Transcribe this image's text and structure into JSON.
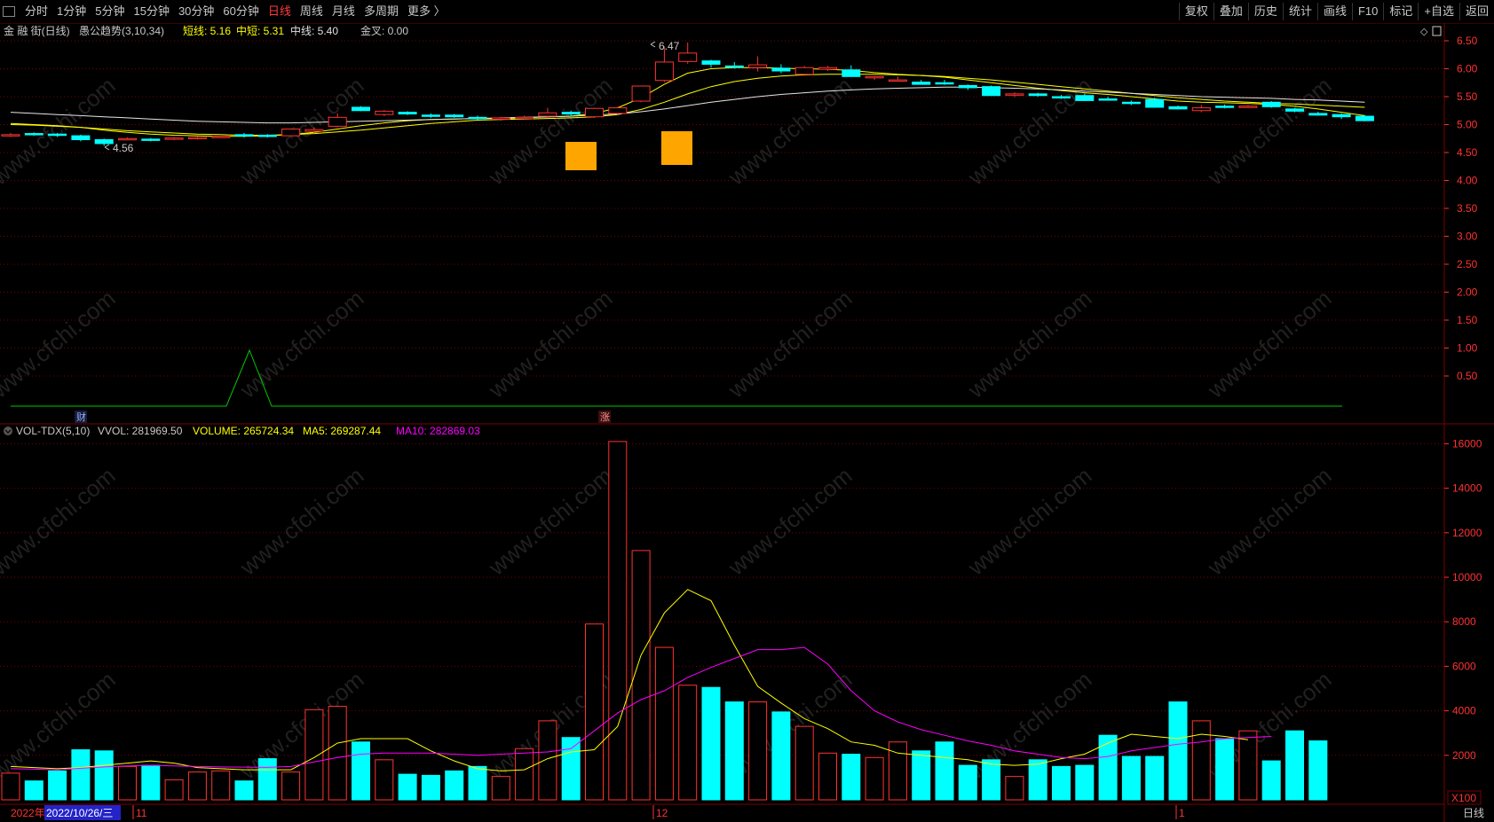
{
  "toolbar": {
    "periods": [
      "分时",
      "1分钟",
      "5分钟",
      "15分钟",
      "30分钟",
      "60分钟",
      "日线",
      "周线",
      "月线",
      "多周期",
      "更多 〉"
    ],
    "active_period": "日线",
    "right_buttons": [
      "复权",
      "叠加",
      "历史",
      "统计",
      "画线",
      "F10",
      "标记",
      "+自选",
      "返回"
    ]
  },
  "main_panel": {
    "stock_name": "金 融 街(日线)",
    "indicator_name": "愚公趋势(3,10,34)",
    "legend": [
      {
        "label": "短线: 5.16",
        "color": "#ffff00"
      },
      {
        "label": "中短: 5.31",
        "color": "#ffff00"
      },
      {
        "label": "中线: 5.40",
        "color": "#e0e0e0"
      },
      {
        "label": "金叉: 0.00",
        "color": "#c8c8c8"
      }
    ],
    "high_marker": "6.47",
    "low_marker": "4.56",
    "event_markers": [
      "财",
      "涨"
    ],
    "price_axis": [
      "6.50",
      "6.00",
      "5.50",
      "5.00",
      "4.50",
      "4.00",
      "3.50",
      "3.00",
      "2.50",
      "2.00",
      "1.50",
      "1.00",
      "0.50"
    ]
  },
  "volume_panel": {
    "indicator_name": "VOL-TDX(5,10)",
    "legend": [
      {
        "label": "VVOL: 281969.50",
        "color": "#c8c8c8"
      },
      {
        "label": "VOLUME: 265724.34",
        "color": "#ffff00"
      },
      {
        "label": "MA5: 269287.44",
        "color": "#ffff00"
      },
      {
        "label": "MA10: 282869.03",
        "color": "#ff00ff"
      }
    ],
    "volume_axis": [
      "16000",
      "14000",
      "12000",
      "10000",
      "8000",
      "6000",
      "4000",
      "2000"
    ],
    "unit": "X100"
  },
  "date_axis": {
    "year_label": "2022年",
    "cursor_date": "2022/10/26/三",
    "month_labels": [
      "11",
      "12",
      "1"
    ],
    "period_label": "日线"
  },
  "watermark": "www.cfchi.com",
  "colors": {
    "up": "#ff3232",
    "down": "#00ffff",
    "ma_short": "#ffff00",
    "ma_mid": "#e6e6e6",
    "ma10": "#ff00ff",
    "signal": "#00c800",
    "grid": "#7a0000",
    "axis_text": "#ff3232"
  },
  "chart_data": {
    "type": "candlestick",
    "dates_span": [
      "2022-10-26",
      "2023-01-19"
    ],
    "candles": [
      [
        4.82,
        4.85,
        4.78,
        4.82
      ],
      [
        4.84,
        4.86,
        4.8,
        4.83
      ],
      [
        4.83,
        4.85,
        4.78,
        4.81
      ],
      [
        4.8,
        4.82,
        4.7,
        4.73
      ],
      [
        4.73,
        4.75,
        4.62,
        4.66
      ],
      [
        4.75,
        4.77,
        4.72,
        4.75
      ],
      [
        4.74,
        4.76,
        4.7,
        4.72
      ],
      [
        4.74,
        4.78,
        4.72,
        4.76
      ],
      [
        4.77,
        4.79,
        4.73,
        4.77
      ],
      [
        4.78,
        4.8,
        4.76,
        4.79
      ],
      [
        4.82,
        4.85,
        4.77,
        4.8
      ],
      [
        4.81,
        4.83,
        4.77,
        4.79
      ],
      [
        4.8,
        4.93,
        4.8,
        4.92
      ],
      [
        4.88,
        4.95,
        4.84,
        4.91
      ],
      [
        4.97,
        5.2,
        4.95,
        5.13
      ],
      [
        5.31,
        5.33,
        5.24,
        5.25
      ],
      [
        5.18,
        5.26,
        5.15,
        5.24
      ],
      [
        5.22,
        5.24,
        5.17,
        5.19
      ],
      [
        5.17,
        5.2,
        5.12,
        5.16
      ],
      [
        5.17,
        5.19,
        5.12,
        5.14
      ],
      [
        5.13,
        5.16,
        5.09,
        5.11
      ],
      [
        5.1,
        5.14,
        5.07,
        5.12
      ],
      [
        5.13,
        5.16,
        5.1,
        5.13
      ],
      [
        5.15,
        5.3,
        5.12,
        5.21
      ],
      [
        5.22,
        5.25,
        5.16,
        5.19
      ],
      [
        5.14,
        5.3,
        5.12,
        5.29
      ],
      [
        5.2,
        5.32,
        5.17,
        5.3
      ],
      [
        5.42,
        5.7,
        5.4,
        5.69
      ],
      [
        5.79,
        6.4,
        5.76,
        6.12
      ],
      [
        6.13,
        6.47,
        6.09,
        6.28
      ],
      [
        6.14,
        6.16,
        6.02,
        6.08
      ],
      [
        6.05,
        6.12,
        6.0,
        6.04
      ],
      [
        6.02,
        6.22,
        5.95,
        6.07
      ],
      [
        6.01,
        6.08,
        5.92,
        5.96
      ],
      [
        5.9,
        6.05,
        5.9,
        6.02
      ],
      [
        5.99,
        6.05,
        5.96,
        6.02
      ],
      [
        5.98,
        6.06,
        5.9,
        5.86
      ],
      [
        5.85,
        5.87,
        5.8,
        5.86
      ],
      [
        5.8,
        5.86,
        5.78,
        5.8
      ],
      [
        5.76,
        5.8,
        5.72,
        5.72
      ],
      [
        5.75,
        5.8,
        5.71,
        5.74
      ],
      [
        5.7,
        5.72,
        5.62,
        5.66
      ],
      [
        5.68,
        5.7,
        5.52,
        5.52
      ],
      [
        5.55,
        5.58,
        5.49,
        5.55
      ],
      [
        5.55,
        5.57,
        5.5,
        5.52
      ],
      [
        5.5,
        5.53,
        5.46,
        5.48
      ],
      [
        5.52,
        5.55,
        5.42,
        5.43
      ],
      [
        5.46,
        5.5,
        5.43,
        5.44
      ],
      [
        5.4,
        5.43,
        5.35,
        5.38
      ],
      [
        5.45,
        5.48,
        5.32,
        5.31
      ],
      [
        5.32,
        5.34,
        5.27,
        5.28
      ],
      [
        5.25,
        5.35,
        5.22,
        5.3
      ],
      [
        5.33,
        5.36,
        5.29,
        5.32
      ],
      [
        5.32,
        5.35,
        5.3,
        5.33
      ],
      [
        5.4,
        5.42,
        5.3,
        5.32
      ],
      [
        5.28,
        5.3,
        5.22,
        5.24
      ],
      [
        5.2,
        5.23,
        5.16,
        5.17
      ],
      [
        5.18,
        5.2,
        5.1,
        5.14
      ],
      [
        5.15,
        5.17,
        5.06,
        5.07
      ]
    ],
    "volume": [
      1200,
      850,
      1300,
      2250,
      2200,
      1500,
      1550,
      900,
      1250,
      1300,
      850,
      1850,
      1250,
      4050,
      4200,
      2600,
      1800,
      1150,
      1100,
      1300,
      1500,
      1050,
      2300,
      3550,
      2800,
      7900,
      16100,
      11200,
      6850,
      5150,
      5050,
      4400,
      4400,
      3950,
      3300,
      2100,
      2050,
      1900,
      2600,
      2200,
      2600,
      1550,
      1800,
      1050,
      1800,
      1500,
      1550,
      2900,
      1950,
      1950,
      4400,
      3550,
      2750,
      3100,
      1750,
      3100,
      2650
    ],
    "series": [
      {
        "name": "短线",
        "values": [
          5.02,
          5.0,
          4.98,
          4.95,
          4.9,
          4.86,
          4.83,
          4.81,
          4.8,
          4.79,
          4.79,
          4.8,
          4.82,
          4.86,
          4.92,
          4.98,
          5.03,
          5.07,
          5.09,
          5.1,
          5.11,
          5.11,
          5.12,
          5.14,
          5.15,
          5.2,
          5.3,
          5.48,
          5.72,
          5.92,
          6.0,
          6.02,
          6.02,
          6.01,
          6.0,
          5.99,
          5.97,
          5.93,
          5.9,
          5.88,
          5.85,
          5.8,
          5.75,
          5.7,
          5.65,
          5.61,
          5.57,
          5.54,
          5.5,
          5.46,
          5.42,
          5.4,
          5.39,
          5.38,
          5.36,
          5.33,
          5.28,
          5.22,
          5.16
        ]
      },
      {
        "name": "中短",
        "values": [
          5.0,
          4.99,
          4.97,
          4.95,
          4.92,
          4.89,
          4.87,
          4.85,
          4.83,
          4.82,
          4.81,
          4.81,
          4.82,
          4.84,
          4.87,
          4.9,
          4.94,
          4.98,
          5.02,
          5.05,
          5.08,
          5.09,
          5.1,
          5.11,
          5.12,
          5.14,
          5.18,
          5.27,
          5.4,
          5.55,
          5.68,
          5.77,
          5.83,
          5.87,
          5.89,
          5.9,
          5.9,
          5.9,
          5.89,
          5.88,
          5.86,
          5.83,
          5.8,
          5.76,
          5.72,
          5.68,
          5.64,
          5.6,
          5.56,
          5.52,
          5.48,
          5.45,
          5.42,
          5.4,
          5.38,
          5.37,
          5.35,
          5.33,
          5.31
        ]
      },
      {
        "name": "中线",
        "values": [
          5.22,
          5.2,
          5.18,
          5.16,
          5.14,
          5.12,
          5.1,
          5.08,
          5.06,
          5.05,
          5.04,
          5.03,
          5.03,
          5.04,
          5.05,
          5.06,
          5.07,
          5.08,
          5.09,
          5.1,
          5.11,
          5.12,
          5.13,
          5.14,
          5.15,
          5.17,
          5.19,
          5.23,
          5.28,
          5.34,
          5.4,
          5.45,
          5.5,
          5.54,
          5.57,
          5.6,
          5.62,
          5.64,
          5.65,
          5.66,
          5.67,
          5.67,
          5.66,
          5.65,
          5.64,
          5.62,
          5.6,
          5.58,
          5.56,
          5.54,
          5.52,
          5.5,
          5.49,
          5.48,
          5.47,
          5.45,
          5.44,
          5.42,
          5.4
        ]
      },
      {
        "name": "MA5",
        "values": [
          1500,
          1450,
          1400,
          1450,
          1550,
          1650,
          1750,
          1650,
          1450,
          1400,
          1350,
          1350,
          1350,
          1900,
          2550,
          2750,
          2750,
          2750,
          2200,
          1750,
          1400,
          1300,
          1350,
          1850,
          2150,
          2250,
          3300,
          6500,
          8400,
          9450,
          8950,
          6950,
          5100,
          4350,
          3650,
          3200,
          2600,
          2450,
          2100,
          2000,
          1900,
          1800,
          1600,
          1550,
          1600,
          1850,
          2050,
          2550,
          2950,
          2850,
          2750,
          2950,
          2850,
          2700
        ]
      },
      {
        "name": "MA10",
        "values": [
          1400,
          1380,
          1350,
          1420,
          1480,
          1520,
          1550,
          1520,
          1500,
          1480,
          1470,
          1460,
          1500,
          1700,
          1900,
          2050,
          2100,
          2100,
          2100,
          2050,
          2000,
          2050,
          2100,
          2150,
          2300,
          3100,
          3900,
          4500,
          4900,
          5500,
          5950,
          6350,
          6750,
          6750,
          6850,
          6100,
          4900,
          4000,
          3500,
          3150,
          2900,
          2650,
          2450,
          2200,
          2050,
          1900,
          1850,
          1950,
          2200,
          2350,
          2500,
          2600,
          2750,
          2800,
          2850
        ]
      }
    ]
  }
}
